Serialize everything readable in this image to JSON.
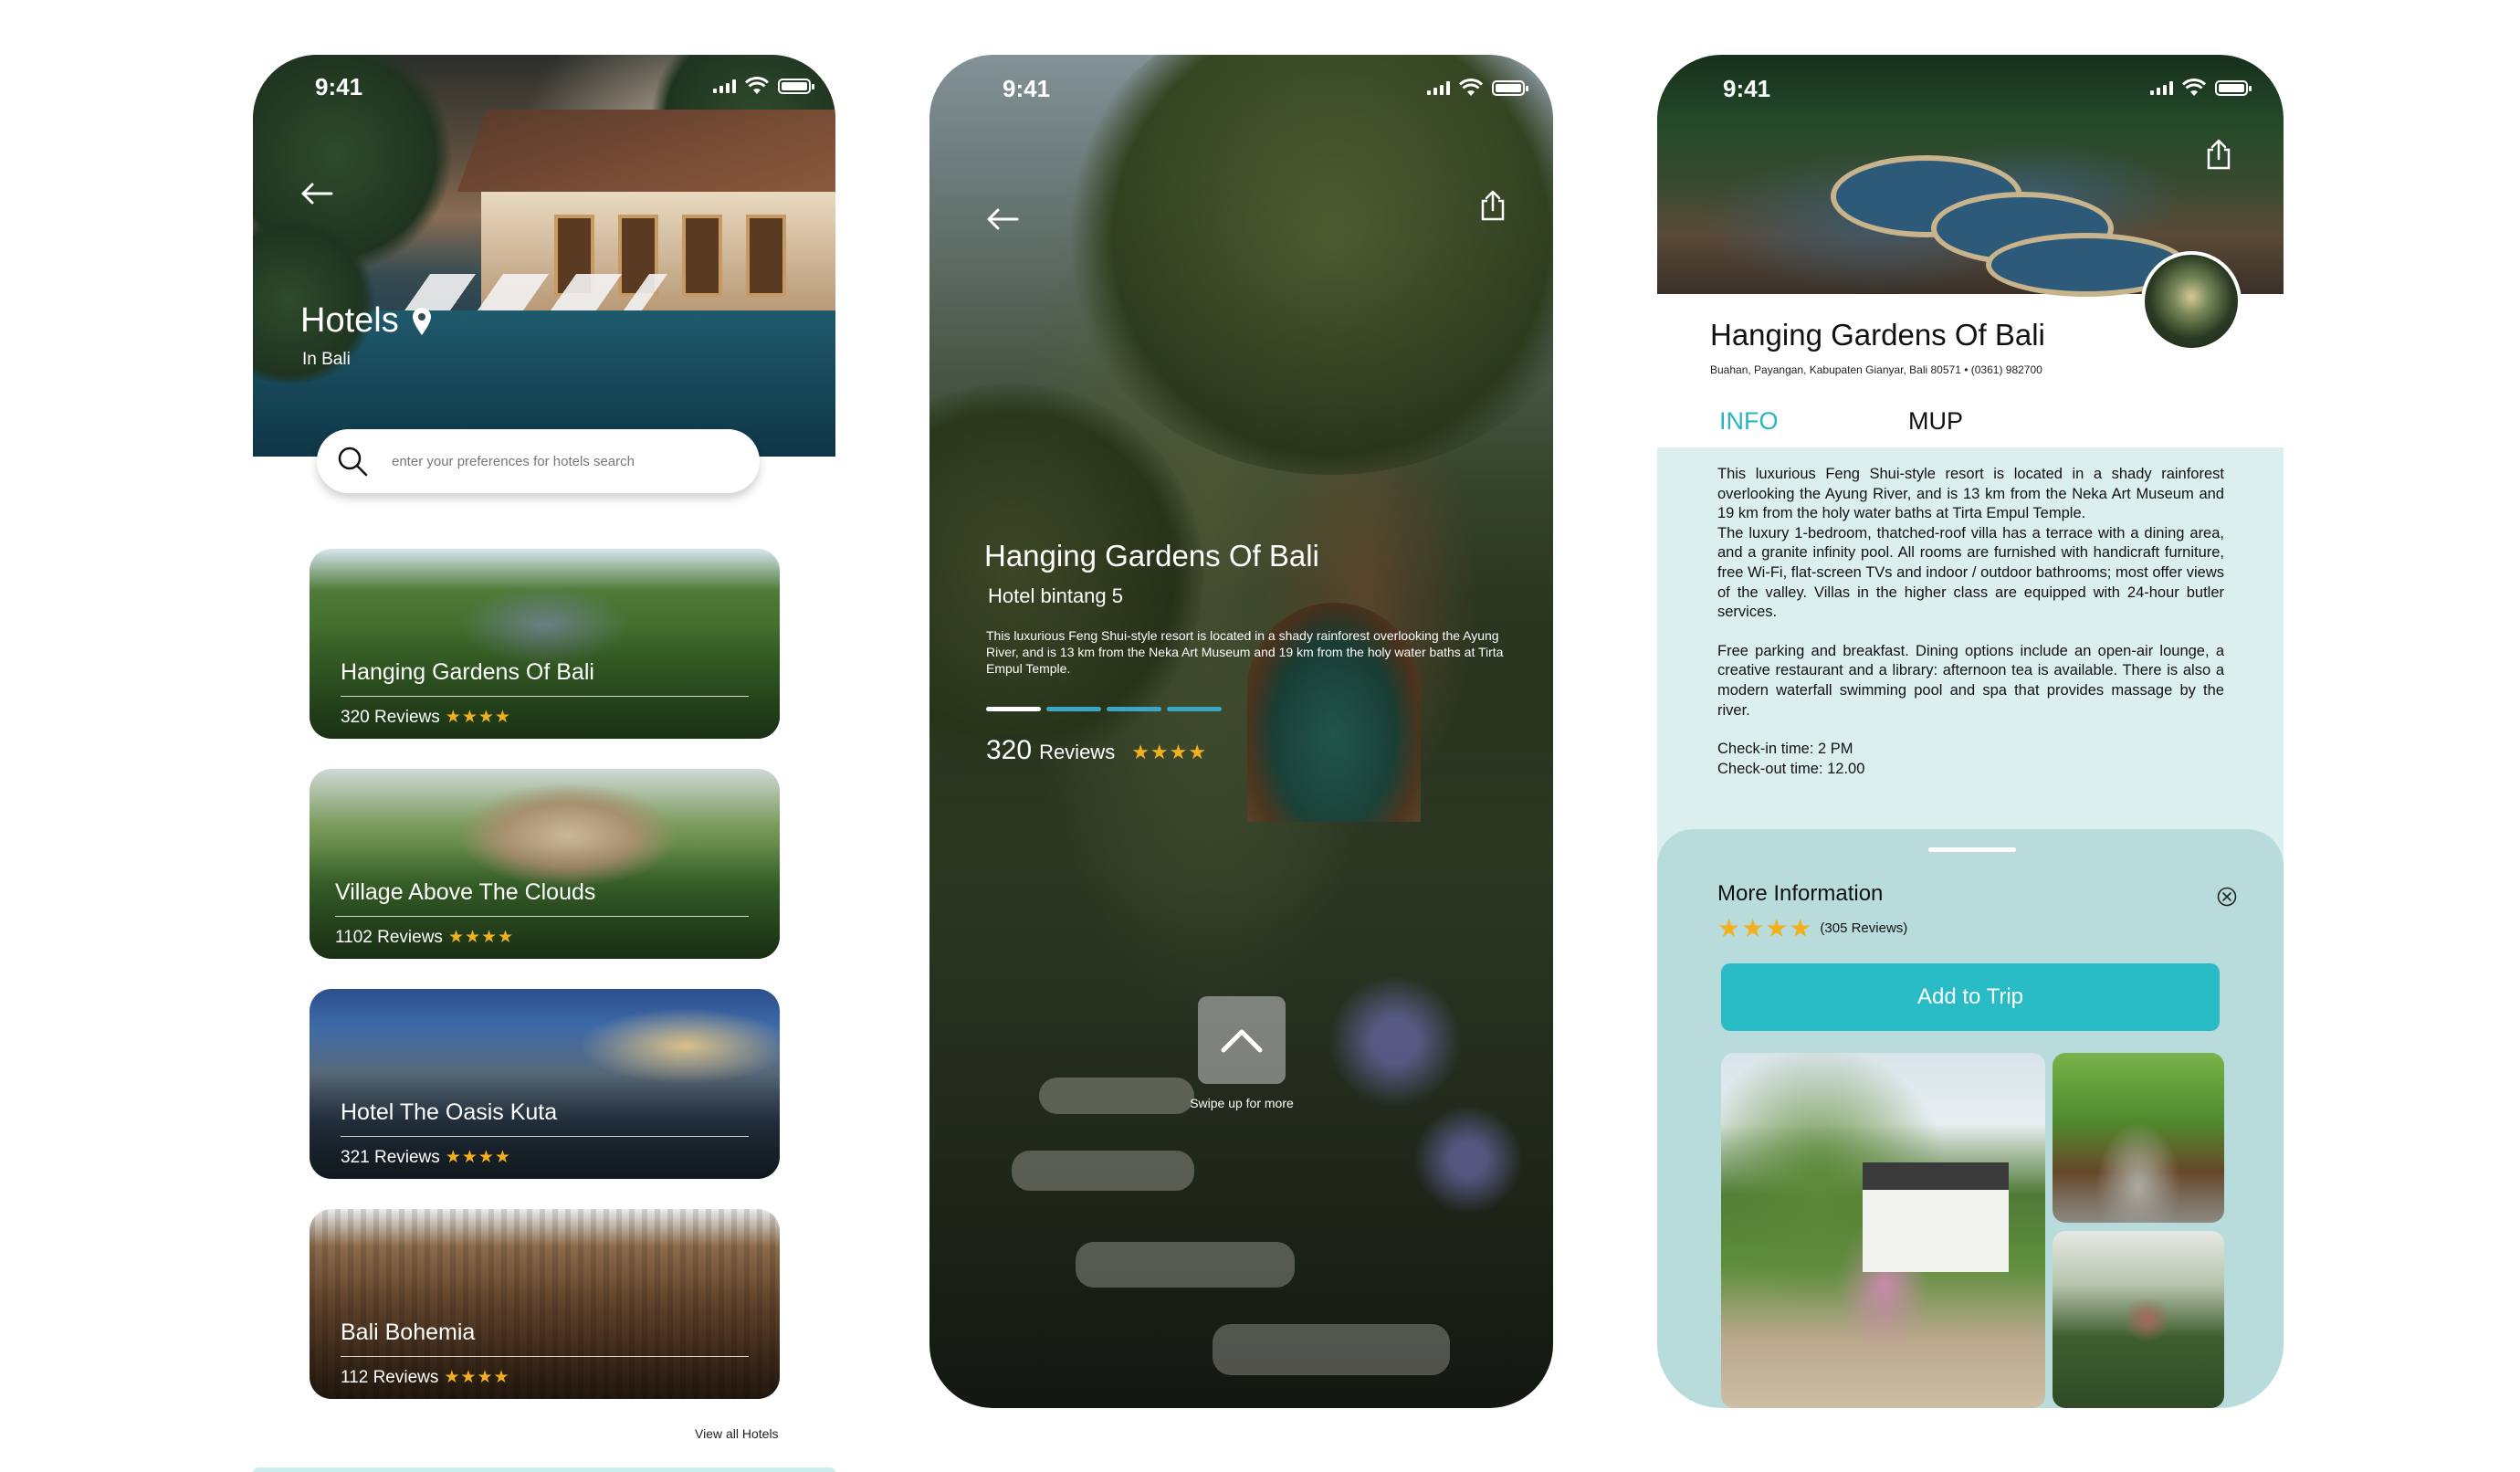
{
  "status_bar": {
    "time": "9:41"
  },
  "screen1": {
    "title": "Hotels",
    "subtitle": "In Bali",
    "search": {
      "placeholder": "enter your preferences for hotels search"
    },
    "hotels": [
      {
        "name": "Hanging Gardens Of Bali",
        "reviews": "320 Reviews",
        "rating": 4
      },
      {
        "name": "Village Above The Clouds",
        "reviews": "1102 Reviews",
        "rating": 4
      },
      {
        "name": "Hotel The Oasis Kuta",
        "reviews": "321 Reviews",
        "rating": 4
      },
      {
        "name": "Bali Bohemia",
        "reviews": "112 Reviews",
        "rating": 4
      }
    ],
    "view_all": "View all Hotels"
  },
  "screen2": {
    "title": "Hanging Gardens Of Bali",
    "subtitle": "Hotel bintang 5",
    "description": "This luxurious Feng Shui-style resort is located in a shady rainforest overlooking the Ayung River, and is 13 km from the Neka Art Museum and 19 km from the holy water baths at Tirta Empul Temple.",
    "review_count": "320",
    "review_label": "Reviews",
    "rating": 4,
    "swipe_label": "Swipe up for more"
  },
  "screen3": {
    "title": "Hanging Gardens Of Bali",
    "address": "Buahan, Payangan, Kabupaten Gianyar, Bali 80571 • (0361) 982700",
    "tabs": {
      "info": "INFO",
      "mup": "MUP"
    },
    "info": {
      "p1": "This luxurious Feng Shui-style resort is located in a shady rainforest overlooking the Ayung River, and is 13 km from the Neka Art Museum and 19 km from the holy water baths at Tirta Empul Temple.",
      "p2": "The luxury 1-bedroom, thatched-roof villa has a terrace with a dining area, and a granite infinity pool. All rooms are furnished with handicraft furniture, free Wi-Fi, flat-screen TVs and indoor / outdoor bathrooms; most offer views of the valley. Villas in the higher class are equipped with 24-hour butler services.",
      "p3": "Free parking and breakfast. Dining options include an open-air lounge, a creative restaurant and a library: afternoon tea is available. There is also a modern waterfall swimming pool and spa that provides massage by the river.",
      "checkin": "Check-in time: 2 PM",
      "checkout": "Check-out time: 12.00"
    },
    "more_info": {
      "title": "More Information",
      "rating": 4,
      "reviews": "(305 Reviews)",
      "button": "Add to Trip"
    }
  },
  "colors": {
    "accent": "#29bcc6",
    "star": "#f2b01e",
    "panel": "#dcefef",
    "sheet": "#b8dcdc"
  },
  "icons": [
    "back-arrow-icon",
    "location-pin-icon",
    "search-icon",
    "share-icon",
    "chevron-up-icon",
    "close-circle-icon",
    "signal-icon",
    "wifi-icon",
    "battery-icon",
    "star-icon"
  ]
}
